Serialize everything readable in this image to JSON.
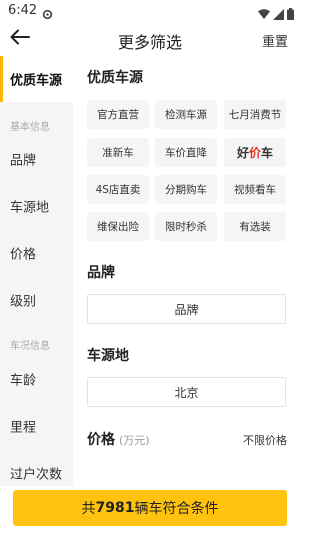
{
  "status_bar": {
    "time": "6:42"
  },
  "header": {
    "title": "更多筛选",
    "reset_label": "重置"
  },
  "sidebar": {
    "items": [
      {
        "label": "优质车源",
        "active": true
      },
      {
        "label": "品牌"
      },
      {
        "label": "车源地"
      },
      {
        "label": "价格"
      },
      {
        "label": "级别"
      },
      {
        "label": "车龄"
      },
      {
        "label": "里程"
      },
      {
        "label": "过户次数"
      }
    ],
    "groups": {
      "basic": "基本信息",
      "condition": "车况信息"
    }
  },
  "sections": {
    "quality": {
      "title": "优质车源",
      "tags": [
        "官方直营",
        "检测车源",
        "七月消费节",
        "准新车",
        "车价直降",
        "好价车",
        "4S店直卖",
        "分期购车",
        "视频看车",
        "维保出险",
        "限时秒杀",
        "有选装"
      ]
    },
    "brand": {
      "title": "品牌",
      "value": "品牌"
    },
    "location": {
      "title": "车源地",
      "value": "北京"
    },
    "price": {
      "title": "价格",
      "unit": "(万元)",
      "value": "不限价格"
    }
  },
  "cta": {
    "prefix": "共",
    "count": "7981",
    "suffix": "辆车符合条件"
  },
  "colors": {
    "accent": "#ffc20e",
    "active_bar": "#ffb400",
    "hao_red": "#e8321f"
  }
}
